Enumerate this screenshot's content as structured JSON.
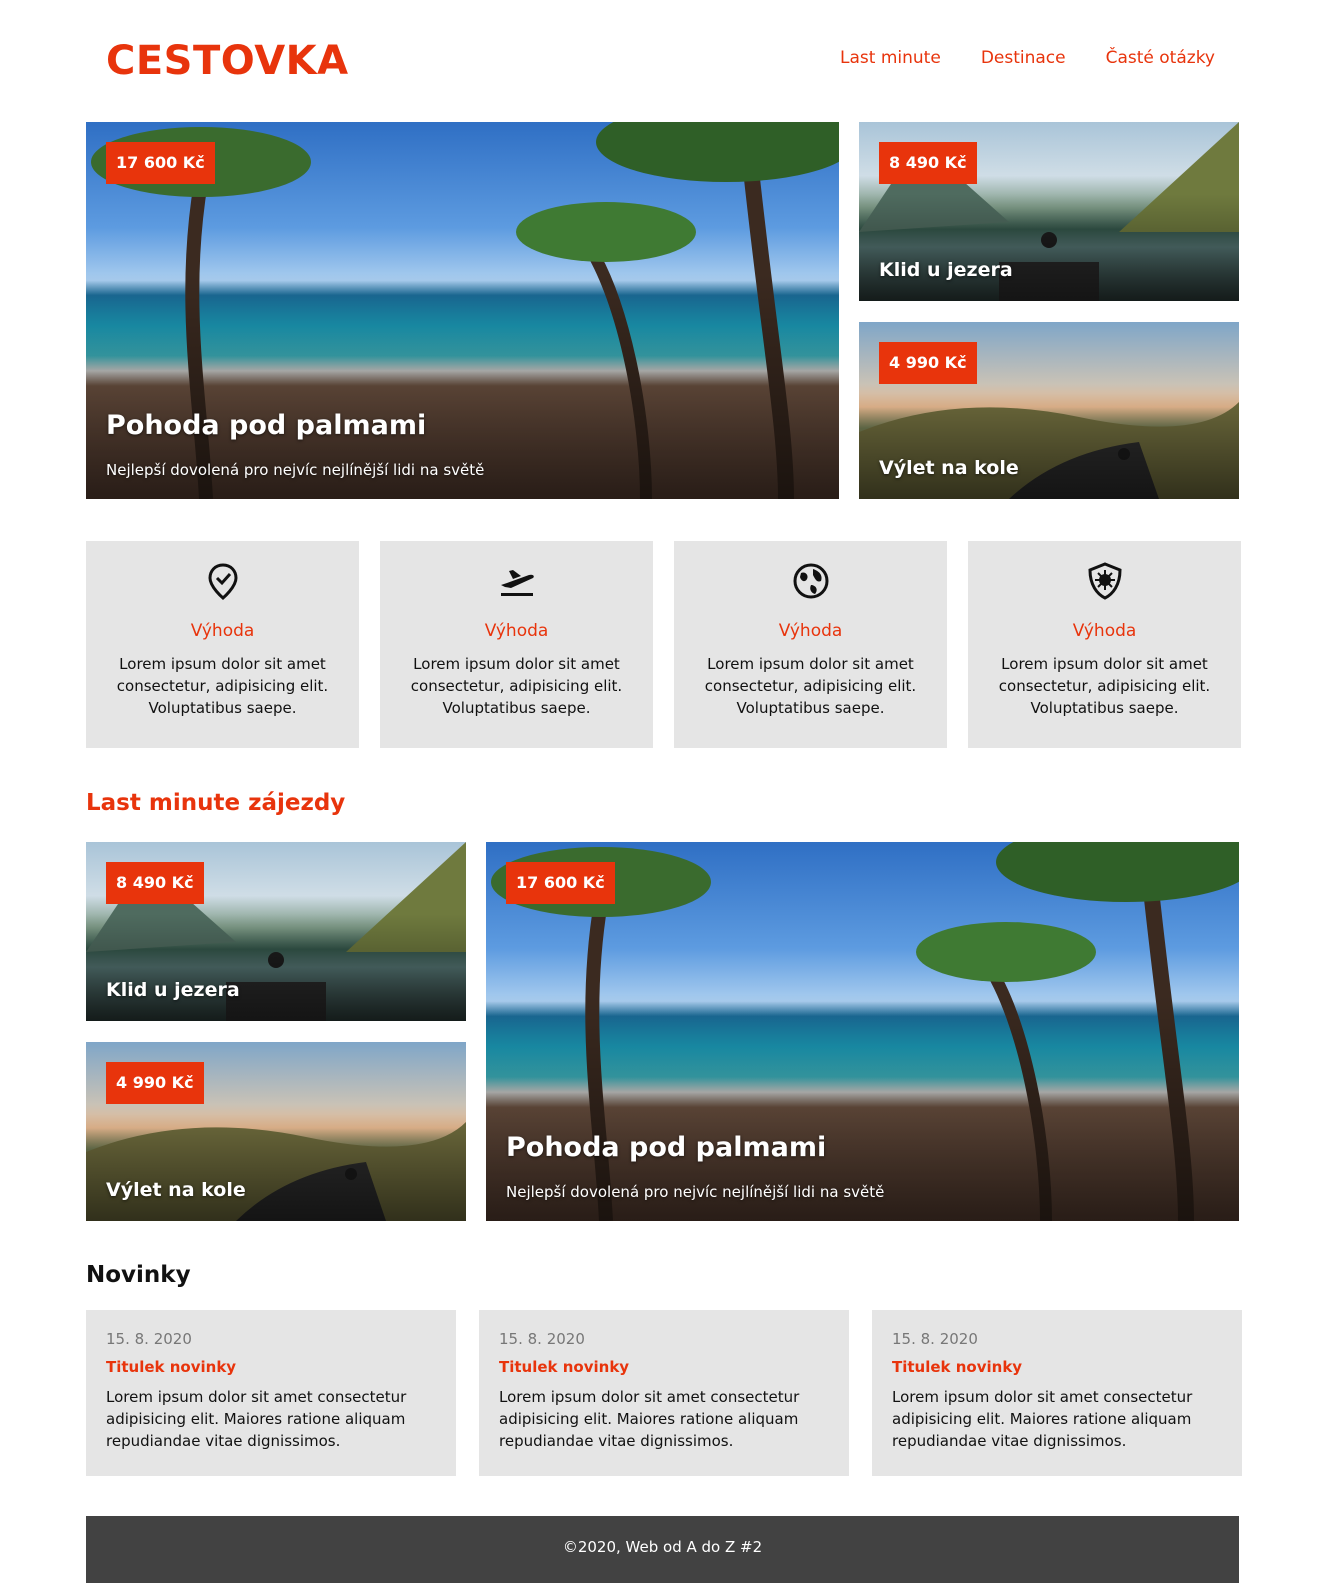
{
  "header": {
    "logo": "CESTOVKA",
    "nav": [
      "Last minute",
      "Destinace",
      "Časté otázky"
    ]
  },
  "hero": {
    "main": {
      "price": "17 600 Kč",
      "title": "Pohoda pod palmami",
      "description": "Nejlepší dovolená pro nejvíc nejlínější lidi na světě"
    },
    "side_top": {
      "price": "8 490 Kč",
      "title": "Klid u jezera"
    },
    "side_bottom": {
      "price": "4 990 Kč",
      "title": "Výlet na kole"
    }
  },
  "features": [
    {
      "icon": "map-pin-check-icon",
      "title": "Výhoda",
      "text": "Lorem ipsum dolor sit amet consectetur, adipisicing elit. Voluptatibus saepe."
    },
    {
      "icon": "plane-takeoff-icon",
      "title": "Výhoda",
      "text": "Lorem ipsum dolor sit amet consectetur, adipisicing elit. Voluptatibus saepe."
    },
    {
      "icon": "globe-icon",
      "title": "Výhoda",
      "text": "Lorem ipsum dolor sit amet consectetur, adipisicing elit. Voluptatibus saepe."
    },
    {
      "icon": "shield-virus-icon",
      "title": "Výhoda",
      "text": "Lorem ipsum dolor sit amet consectetur, adipisicing elit. Voluptatibus saepe."
    }
  ],
  "last_minute": {
    "heading": "Last minute zájezdy",
    "left_top": {
      "price": "8 490 Kč",
      "title": "Klid u jezera"
    },
    "left_bottom": {
      "price": "4 990 Kč",
      "title": "Výlet na kole"
    },
    "main": {
      "price": "17 600 Kč",
      "title": "Pohoda pod palmami",
      "description": "Nejlepší dovolená pro nejvíc nejlínější lidi na světě"
    }
  },
  "news": {
    "heading": "Novinky",
    "items": [
      {
        "date": "15. 8. 2020",
        "title": "Titulek novinky",
        "text": "Lorem ipsum dolor sit amet consectetur adipisicing elit. Maiores ratione aliquam repudiandae vitae dignissimos."
      },
      {
        "date": "15. 8. 2020",
        "title": "Titulek novinky",
        "text": "Lorem ipsum dolor sit amet consectetur adipisicing elit. Maiores ratione aliquam repudiandae vitae dignissimos."
      },
      {
        "date": "15. 8. 2020",
        "title": "Titulek novinky",
        "text": "Lorem ipsum dolor sit amet consectetur adipisicing elit. Maiores ratione aliquam repudiandae vitae dignissimos."
      }
    ]
  },
  "footer": {
    "text": "©2020, Web od A do Z #2"
  },
  "colors": {
    "accent": "#e8340c",
    "card_bg": "#e5e5e5",
    "footer_bg": "#424242"
  }
}
